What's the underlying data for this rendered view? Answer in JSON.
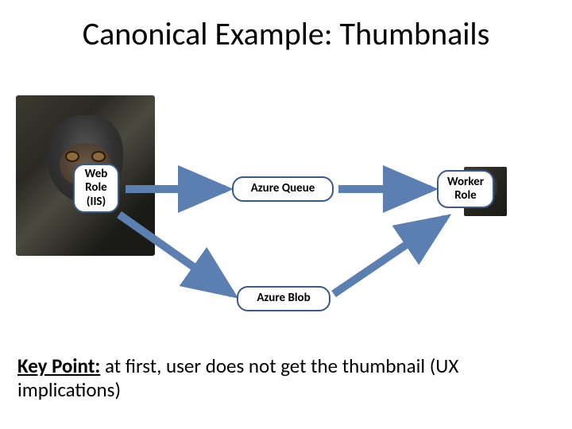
{
  "title": "Canonical Example: Thumbnails",
  "nodes": {
    "web": "Web\nRole\n(IIS)",
    "queue": "Azure Queue",
    "worker": "Worker\nRole",
    "blob": "Azure Blob"
  },
  "arrows": {
    "color": "#5b7fb0",
    "paths": [
      {
        "from": "web",
        "to": "queue"
      },
      {
        "from": "queue",
        "to": "worker"
      },
      {
        "from": "web",
        "to": "blob"
      },
      {
        "from": "blob",
        "to": "worker"
      }
    ]
  },
  "images": {
    "large_desc": "large gorilla photo",
    "small_desc": "small gorilla thumbnail"
  },
  "keypoint": {
    "label": "Key Point:",
    "text": " at first, user does not get the thumbnail (UX implications)"
  }
}
